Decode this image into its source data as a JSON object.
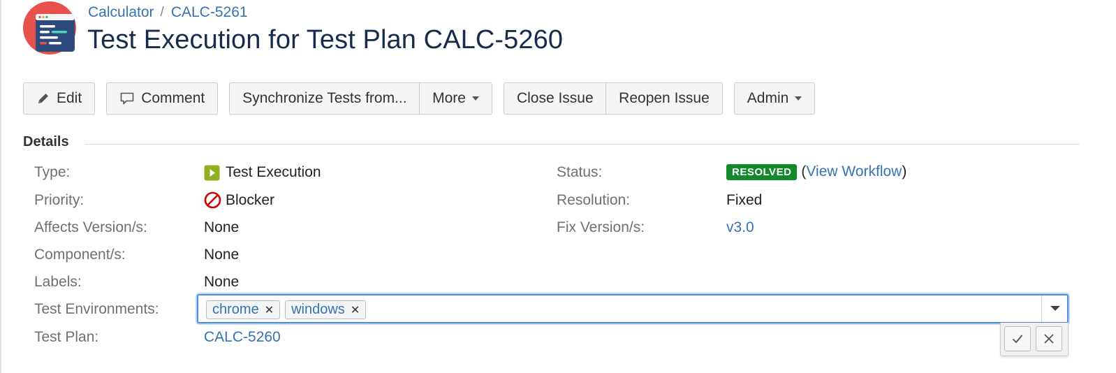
{
  "breadcrumb": {
    "project": "Calculator",
    "issue_key": "CALC-5261"
  },
  "page_title": "Test Execution for Test Plan CALC-5260",
  "toolbar": {
    "edit": "Edit",
    "comment": "Comment",
    "synchronize": "Synchronize Tests from...",
    "more": "More",
    "close_issue": "Close Issue",
    "reopen_issue": "Reopen Issue",
    "admin": "Admin"
  },
  "details": {
    "heading": "Details",
    "type": {
      "label": "Type:",
      "value": "Test Execution",
      "icon": "test-execution-icon"
    },
    "priority": {
      "label": "Priority:",
      "value": "Blocker",
      "icon": "blocker-icon"
    },
    "affects_versions": {
      "label": "Affects Version/s:",
      "value": "None"
    },
    "components": {
      "label": "Component/s:",
      "value": "None"
    },
    "labels": {
      "label": "Labels:",
      "value": "None"
    },
    "test_environments": {
      "label": "Test Environments:",
      "chips": [
        "chrome",
        "windows"
      ]
    },
    "test_plan": {
      "label": "Test Plan:",
      "value": "CALC-5260"
    },
    "status": {
      "label": "Status:",
      "badge": "RESOLVED",
      "paren_open": "(",
      "link": "View Workflow",
      "paren_close": ")"
    },
    "resolution": {
      "label": "Resolution:",
      "value": "Fixed"
    },
    "fix_versions": {
      "label": "Fix Version/s:",
      "value": "v3.0"
    }
  },
  "colors": {
    "link": "#3572b0",
    "resolved_badge": "#14892c",
    "focus_border": "#4a90e2",
    "logo_red": "#e8514a",
    "logo_navy": "#2d4a7c"
  }
}
